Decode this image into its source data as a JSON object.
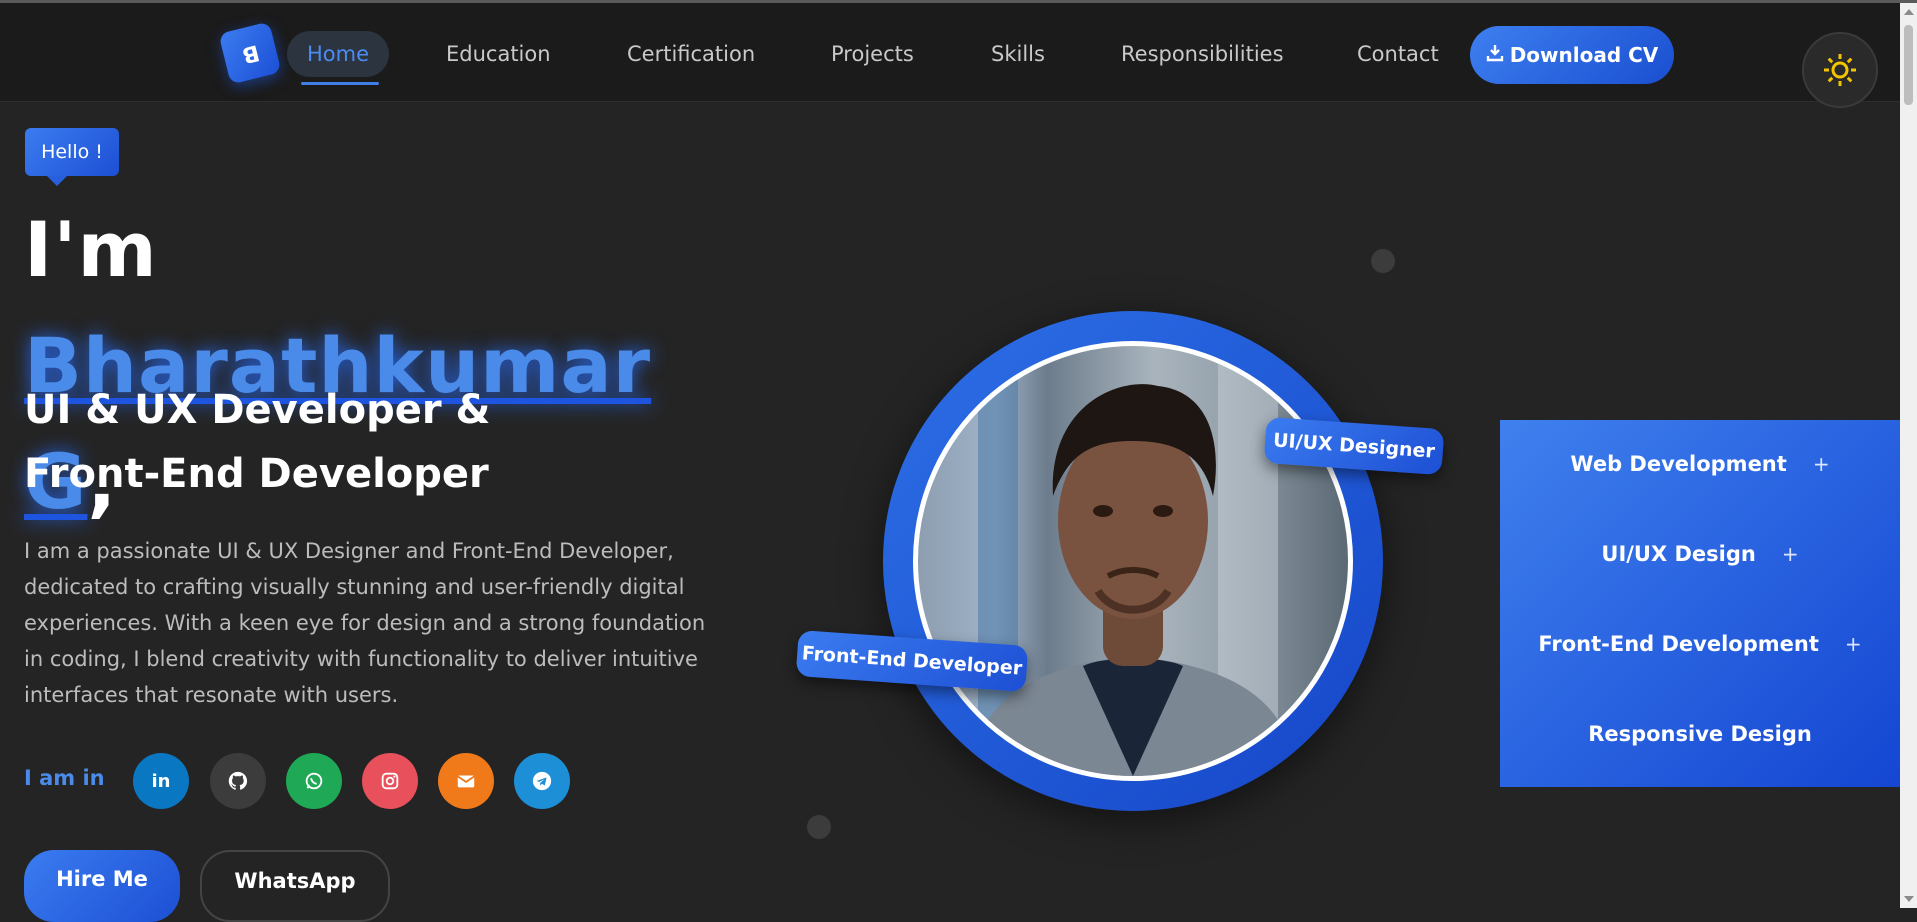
{
  "nav": {
    "logo": "B",
    "items": [
      "Home",
      "Education",
      "Certification",
      "Projects",
      "Skills",
      "Responsibilities",
      "Contact"
    ],
    "cta": "Download CV",
    "theme_icon": "sun-icon"
  },
  "hero": {
    "badge": "Hello !",
    "greeting": "I'm ",
    "name": "Bharathkumar G",
    "comma": ",",
    "subtitle_line1": "UI & UX Developer &",
    "subtitle_line2": "Front-End Developer",
    "description": "I am a passionate UI & UX Designer and Front-End Developer, dedicated to crafting visually stunning and user-friendly digital experiences. With a keen eye for design and a strong foundation in coding, I blend creativity with functionality to deliver intuitive interfaces that resonate with users.",
    "social_label": "I am in",
    "social": [
      {
        "name": "linkedin-icon",
        "label": "in",
        "color": "#0a77c2"
      },
      {
        "name": "github-icon",
        "label": "",
        "color": "#3c3c3c"
      },
      {
        "name": "whatsapp-icon",
        "label": "",
        "color": "#1fa855"
      },
      {
        "name": "instagram-icon",
        "label": "",
        "color": "#e8505b"
      },
      {
        "name": "email-icon",
        "label": "",
        "color": "#f07a1a"
      },
      {
        "name": "telegram-icon",
        "label": "",
        "color": "#1c8fd6"
      }
    ],
    "hire_label": "Hire Me",
    "whatsapp_label": "WhatsApp"
  },
  "portrait": {
    "tag_top": "UI/UX Designer",
    "tag_bottom": "Front-End Developer"
  },
  "services": [
    {
      "label": "Web Development",
      "plus": "+"
    },
    {
      "label": "UI/UX Design",
      "plus": "+"
    },
    {
      "label": "Front-End Development",
      "plus": "+"
    },
    {
      "label": "Responsive Design",
      "plus": ""
    }
  ],
  "colors": {
    "accent": "#3b7cf0",
    "accent_dark": "#1a4fd0",
    "background": "#242424",
    "nav_bg": "#1b1b1b",
    "sun": "#f2c500"
  }
}
